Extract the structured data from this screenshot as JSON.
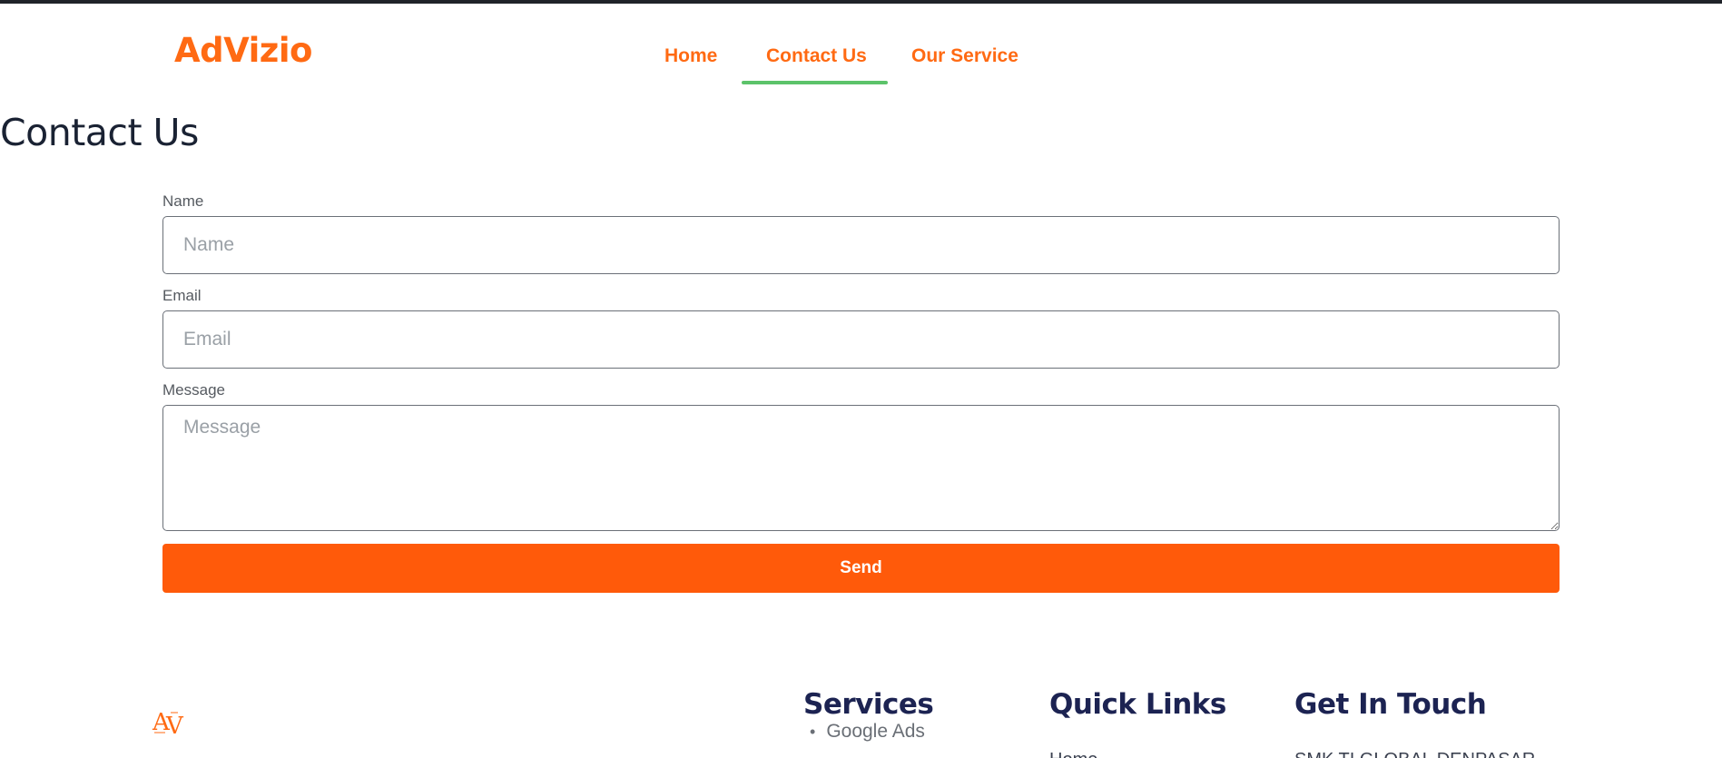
{
  "header": {
    "brand": "AdVizio",
    "nav": [
      {
        "label": "Home"
      },
      {
        "label": "Contact Us",
        "active": true
      },
      {
        "label": "Our Service"
      }
    ],
    "active_underline_color": "#5cc36a",
    "accent_color": "#ff6a13"
  },
  "page": {
    "title": "Contact Us"
  },
  "form": {
    "name": {
      "label": "Name",
      "placeholder": "Name",
      "value": ""
    },
    "email": {
      "label": "Email",
      "placeholder": "Email",
      "value": ""
    },
    "message": {
      "label": "Message",
      "placeholder": "Message",
      "value": ""
    },
    "send_label": "Send",
    "button_color": "#ff5a0a"
  },
  "footer": {
    "logo_icon": "advizio-logo-icon",
    "services": {
      "title": "Services",
      "items": [
        "Google Ads"
      ]
    },
    "quick_links": {
      "title": "Quick Links",
      "first_item": "Home"
    },
    "get_in_touch": {
      "title": "Get In Touch",
      "first_item": "SMK TI GLOBAL DENPASAR"
    }
  }
}
